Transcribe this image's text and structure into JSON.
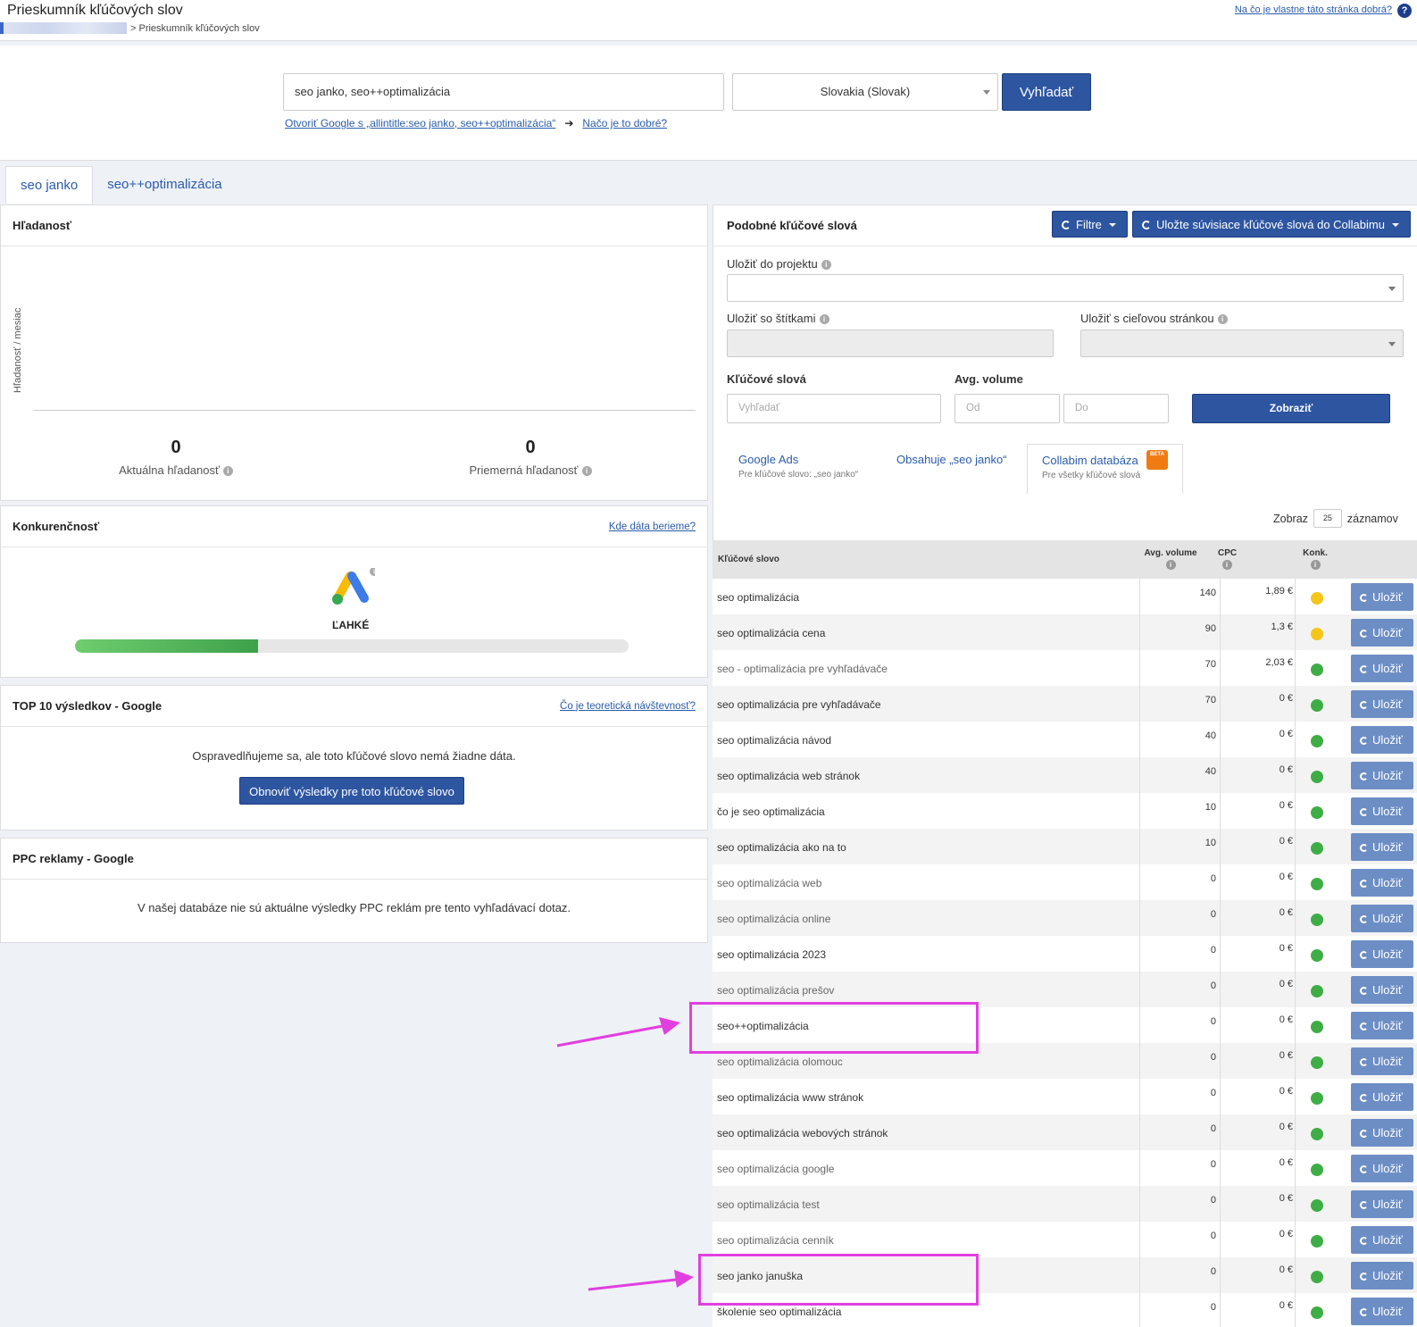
{
  "header": {
    "title": "Prieskumník kľúčových slov",
    "breadcrumb_current": "> Prieskumník kľúčových slov",
    "help_link": "Na čo je vlastne táto stránka dobrá?",
    "help_icon": "?"
  },
  "search": {
    "query": "seo janko, seo++optimalizácia",
    "country": "Slovakia (Slovak)",
    "button": "Vyhľadať",
    "google_link": "Otvoriť Google s „allintitle:seo janko, seo++optimalizácia“",
    "why_link": "Načo je to dobré?"
  },
  "keyword_tabs": [
    {
      "label": "seo janko",
      "active": true
    },
    {
      "label": "seo++optimalizácia",
      "active": false
    }
  ],
  "volume_panel": {
    "title": "Hľadanosť",
    "y_axis_label": "Hľadanosť / mesiac",
    "current_value": "0",
    "current_label": "Aktuálna hľadanosť",
    "average_value": "0",
    "average_label": "Priemerná hľadanosť"
  },
  "competition_panel": {
    "title": "Konkurenčnosť",
    "link": "Kde dáta berieme?",
    "difficulty": "ĽAHKÉ",
    "level": 0.33
  },
  "top10_panel": {
    "title": "TOP 10 výsledkov - Google",
    "link": "Čo je teoretická návštevnosť?",
    "message": "Ospravedlňujeme sa, ale toto kľúčové slovo nemá žiadne dáta.",
    "button": "Obnoviť výsledky pre toto kľúčové slovo"
  },
  "ppc_panel": {
    "title": "PPC reklamy - Google",
    "message": "V našej databáze nie sú aktuálne výsledky PPC reklám pre tento vyhľadávací dotaz."
  },
  "similar_panel": {
    "title": "Podobné kľúčové slová",
    "filters_button": "Filtre",
    "save_all_button": "Uložte súvisiace kľúčové slová do Collabimu",
    "project_label": "Uložiť do projektu",
    "tags_label": "Uložiť so štítkami",
    "target_label": "Uložiť s cieľovou stránkou",
    "keywords_label": "Kľúčové slová",
    "keywords_placeholder": "Vyhľadať",
    "avg_volume_label": "Avg. volume",
    "from_placeholder": "Od",
    "to_placeholder": "Do",
    "show_button": "Zobraziť",
    "source_tabs": [
      {
        "title": "Google Ads",
        "sub": "Pre kľúčové slovo: „seo janko“"
      },
      {
        "title": "Obsahuje „seo janko“",
        "sub": ""
      },
      {
        "title": "Collabim databáza",
        "sub": "Pre všetky kľúčové slová",
        "badge": "BETA"
      }
    ],
    "show_prefix": "Zobraz",
    "show_count": "25",
    "show_suffix": "záznamov",
    "columns": {
      "keyword": "Kľúčové slovo",
      "volume": "Avg. volume",
      "cpc": "CPC",
      "competition": "Konk."
    },
    "save_label": "Uložiť",
    "colors": {
      "easy": "#3fad46",
      "medium": "#f5c518"
    },
    "rows": [
      {
        "keyword": "seo optimalizácia",
        "volume": "140",
        "cpc": "1,89 €",
        "level": "medium"
      },
      {
        "keyword": "seo optimalizácia cena",
        "volume": "90",
        "cpc": "1,3 €",
        "level": "medium"
      },
      {
        "keyword": "seo - optimalizácia pre vyhľadávače",
        "volume": "70",
        "cpc": "2,03 €",
        "level": "easy"
      },
      {
        "keyword": "seo optimalizácia pre vyhľadávače",
        "volume": "70",
        "cpc": "0 €",
        "level": "easy"
      },
      {
        "keyword": "seo optimalizácia návod",
        "volume": "40",
        "cpc": "0 €",
        "level": "easy"
      },
      {
        "keyword": "seo optimalizácia web stránok",
        "volume": "40",
        "cpc": "0 €",
        "level": "easy"
      },
      {
        "keyword": "čo je seo optimalizácia",
        "volume": "10",
        "cpc": "0 €",
        "level": "easy"
      },
      {
        "keyword": "seo optimalizácia ako na to",
        "volume": "10",
        "cpc": "0 €",
        "level": "easy"
      },
      {
        "keyword": "seo optimalizácia web",
        "volume": "0",
        "cpc": "0 €",
        "level": "easy"
      },
      {
        "keyword": "seo optimalizácia online",
        "volume": "0",
        "cpc": "0 €",
        "level": "easy"
      },
      {
        "keyword": "seo optimalizácia 2023",
        "volume": "0",
        "cpc": "0 €",
        "level": "easy"
      },
      {
        "keyword": "seo optimalizácia prešov",
        "volume": "0",
        "cpc": "0 €",
        "level": "easy"
      },
      {
        "keyword": "seo++optimalizácia",
        "volume": "0",
        "cpc": "0 €",
        "level": "easy"
      },
      {
        "keyword": "seo optimalizácia olomouc",
        "volume": "0",
        "cpc": "0 €",
        "level": "easy"
      },
      {
        "keyword": "seo optimalizácia www stránok",
        "volume": "0",
        "cpc": "0 €",
        "level": "easy"
      },
      {
        "keyword": "seo optimalizácia webových stránok",
        "volume": "0",
        "cpc": "0 €",
        "level": "easy"
      },
      {
        "keyword": "seo optimalizácia google",
        "volume": "0",
        "cpc": "0 €",
        "level": "easy"
      },
      {
        "keyword": "seo optimalizácia test",
        "volume": "0",
        "cpc": "0 €",
        "level": "easy"
      },
      {
        "keyword": "seo optimalizácia cenník",
        "volume": "0",
        "cpc": "0 €",
        "level": "easy"
      },
      {
        "keyword": "seo janko januška",
        "volume": "0",
        "cpc": "0 €",
        "level": "easy"
      },
      {
        "keyword": "školenie seo optimalizácia",
        "volume": "0",
        "cpc": "0 €",
        "level": "easy"
      }
    ]
  }
}
